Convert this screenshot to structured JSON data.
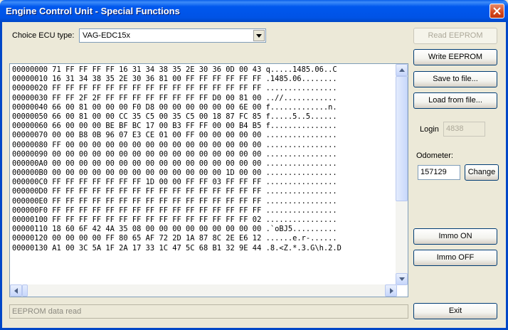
{
  "window": {
    "title": "Engine Control Unit - Special Functions"
  },
  "ecu": {
    "label": "Choice ECU type:",
    "selected": "VAG-EDC15x"
  },
  "hex_rows": [
    "00000000 71 FF FF FF FF 16 31 34 38 35 2E 30 36 0D 00 43 q.....1485.06..C",
    "00000010 16 31 34 38 35 2E 30 36 81 00 FF FF FF FF FF FF .1485.06........",
    "00000020 FF FF FF FF FF FF FF FF FF FF FF FF FF FF FF FF ................",
    "00000030 FF FF 2F 2F FF FF FF FF FF FF FF FF D0 00 81 00 ..//............",
    "00000040 66 00 81 00 00 00 F0 D8 00 00 00 00 00 00 6E 00 f.............n.",
    "00000050 66 00 81 00 00 CC 35 C5 00 35 C5 00 18 87 FC 85 f.....5..5......",
    "00000060 66 00 00 00 BE BF BC 17 00 B3 FF FF 00 00 B4 B5 f...............",
    "00000070 00 00 B8 0B 96 07 E3 CE 01 00 FF 00 00 00 00 00 ................",
    "00000080 FF 00 00 00 00 00 00 00 00 00 00 00 00 00 00 00 ................",
    "00000090 00 00 00 00 00 00 00 00 00 00 00 00 00 00 00 00 ................",
    "000000A0 00 00 00 00 00 00 00 00 00 00 00 00 00 00 00 00 ................",
    "000000B0 00 00 00 00 00 00 00 00 00 00 00 00 00 1D 00 00 ................",
    "000000C0 FF FF FF FF FF FF FF 1D 00 00 FF FF 03 FF FF FF ................",
    "000000D0 FF FF FF FF FF FF FF FF FF FF FF FF FF FF FF FF ................",
    "000000E0 FF FF FF FF FF FF FF FF FF FF FF FF FF FF FF FF ................",
    "000000F0 FF FF FF FF FF FF FF FF FF FF FF FF FF FF FF FF ................",
    "00000100 FF FF FF FF FF FF FF FF FF FF FF FF FF FF FF 02 ................",
    "00000110 18 60 6F 42 4A 35 08 00 00 00 00 00 00 00 00 00 .`oBJ5..........",
    "00000120 00 00 00 00 FF 80 65 AF 72 2D 1A 87 8C 2E E6 12 ......e.r-......",
    "00000130 A1 00 3C 5A 1F 2A 17 33 1C 47 5C 68 B1 32 9E 44 .8.<Z.*.3.G\\h.2.D"
  ],
  "status": {
    "text": "EEPROM data read"
  },
  "buttons": {
    "read_eeprom": "Read EEPROM",
    "write_eeprom": "Write EEPROM",
    "save_to_file": "Save to file...",
    "load_from_file": "Load from file...",
    "change": "Change",
    "immo_on": "Immo ON",
    "immo_off": "Immo OFF",
    "exit": "Exit"
  },
  "login": {
    "label": "Login",
    "value": "4838"
  },
  "odometer": {
    "label": "Odometer:",
    "value": "157129"
  }
}
